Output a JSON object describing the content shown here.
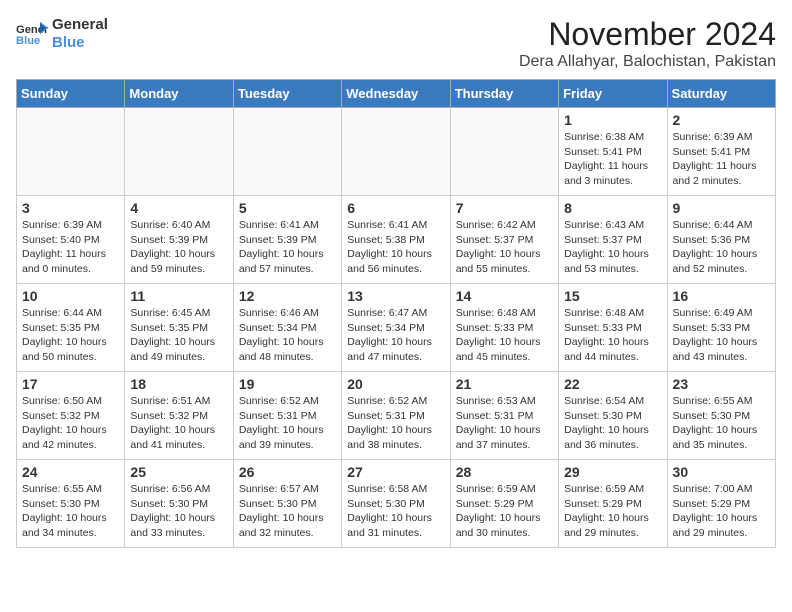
{
  "header": {
    "logo": {
      "line1": "General",
      "line2": "Blue"
    },
    "title": "November 2024",
    "location": "Dera Allahyar, Balochistan, Pakistan"
  },
  "calendar": {
    "days_of_week": [
      "Sunday",
      "Monday",
      "Tuesday",
      "Wednesday",
      "Thursday",
      "Friday",
      "Saturday"
    ],
    "weeks": [
      [
        {
          "day": "",
          "info": ""
        },
        {
          "day": "",
          "info": ""
        },
        {
          "day": "",
          "info": ""
        },
        {
          "day": "",
          "info": ""
        },
        {
          "day": "",
          "info": ""
        },
        {
          "day": "1",
          "info": "Sunrise: 6:38 AM\nSunset: 5:41 PM\nDaylight: 11 hours\nand 3 minutes."
        },
        {
          "day": "2",
          "info": "Sunrise: 6:39 AM\nSunset: 5:41 PM\nDaylight: 11 hours\nand 2 minutes."
        }
      ],
      [
        {
          "day": "3",
          "info": "Sunrise: 6:39 AM\nSunset: 5:40 PM\nDaylight: 11 hours\nand 0 minutes."
        },
        {
          "day": "4",
          "info": "Sunrise: 6:40 AM\nSunset: 5:39 PM\nDaylight: 10 hours\nand 59 minutes."
        },
        {
          "day": "5",
          "info": "Sunrise: 6:41 AM\nSunset: 5:39 PM\nDaylight: 10 hours\nand 57 minutes."
        },
        {
          "day": "6",
          "info": "Sunrise: 6:41 AM\nSunset: 5:38 PM\nDaylight: 10 hours\nand 56 minutes."
        },
        {
          "day": "7",
          "info": "Sunrise: 6:42 AM\nSunset: 5:37 PM\nDaylight: 10 hours\nand 55 minutes."
        },
        {
          "day": "8",
          "info": "Sunrise: 6:43 AM\nSunset: 5:37 PM\nDaylight: 10 hours\nand 53 minutes."
        },
        {
          "day": "9",
          "info": "Sunrise: 6:44 AM\nSunset: 5:36 PM\nDaylight: 10 hours\nand 52 minutes."
        }
      ],
      [
        {
          "day": "10",
          "info": "Sunrise: 6:44 AM\nSunset: 5:35 PM\nDaylight: 10 hours\nand 50 minutes."
        },
        {
          "day": "11",
          "info": "Sunrise: 6:45 AM\nSunset: 5:35 PM\nDaylight: 10 hours\nand 49 minutes."
        },
        {
          "day": "12",
          "info": "Sunrise: 6:46 AM\nSunset: 5:34 PM\nDaylight: 10 hours\nand 48 minutes."
        },
        {
          "day": "13",
          "info": "Sunrise: 6:47 AM\nSunset: 5:34 PM\nDaylight: 10 hours\nand 47 minutes."
        },
        {
          "day": "14",
          "info": "Sunrise: 6:48 AM\nSunset: 5:33 PM\nDaylight: 10 hours\nand 45 minutes."
        },
        {
          "day": "15",
          "info": "Sunrise: 6:48 AM\nSunset: 5:33 PM\nDaylight: 10 hours\nand 44 minutes."
        },
        {
          "day": "16",
          "info": "Sunrise: 6:49 AM\nSunset: 5:33 PM\nDaylight: 10 hours\nand 43 minutes."
        }
      ],
      [
        {
          "day": "17",
          "info": "Sunrise: 6:50 AM\nSunset: 5:32 PM\nDaylight: 10 hours\nand 42 minutes."
        },
        {
          "day": "18",
          "info": "Sunrise: 6:51 AM\nSunset: 5:32 PM\nDaylight: 10 hours\nand 41 minutes."
        },
        {
          "day": "19",
          "info": "Sunrise: 6:52 AM\nSunset: 5:31 PM\nDaylight: 10 hours\nand 39 minutes."
        },
        {
          "day": "20",
          "info": "Sunrise: 6:52 AM\nSunset: 5:31 PM\nDaylight: 10 hours\nand 38 minutes."
        },
        {
          "day": "21",
          "info": "Sunrise: 6:53 AM\nSunset: 5:31 PM\nDaylight: 10 hours\nand 37 minutes."
        },
        {
          "day": "22",
          "info": "Sunrise: 6:54 AM\nSunset: 5:30 PM\nDaylight: 10 hours\nand 36 minutes."
        },
        {
          "day": "23",
          "info": "Sunrise: 6:55 AM\nSunset: 5:30 PM\nDaylight: 10 hours\nand 35 minutes."
        }
      ],
      [
        {
          "day": "24",
          "info": "Sunrise: 6:55 AM\nSunset: 5:30 PM\nDaylight: 10 hours\nand 34 minutes."
        },
        {
          "day": "25",
          "info": "Sunrise: 6:56 AM\nSunset: 5:30 PM\nDaylight: 10 hours\nand 33 minutes."
        },
        {
          "day": "26",
          "info": "Sunrise: 6:57 AM\nSunset: 5:30 PM\nDaylight: 10 hours\nand 32 minutes."
        },
        {
          "day": "27",
          "info": "Sunrise: 6:58 AM\nSunset: 5:30 PM\nDaylight: 10 hours\nand 31 minutes."
        },
        {
          "day": "28",
          "info": "Sunrise: 6:59 AM\nSunset: 5:29 PM\nDaylight: 10 hours\nand 30 minutes."
        },
        {
          "day": "29",
          "info": "Sunrise: 6:59 AM\nSunset: 5:29 PM\nDaylight: 10 hours\nand 29 minutes."
        },
        {
          "day": "30",
          "info": "Sunrise: 7:00 AM\nSunset: 5:29 PM\nDaylight: 10 hours\nand 29 minutes."
        }
      ]
    ]
  }
}
